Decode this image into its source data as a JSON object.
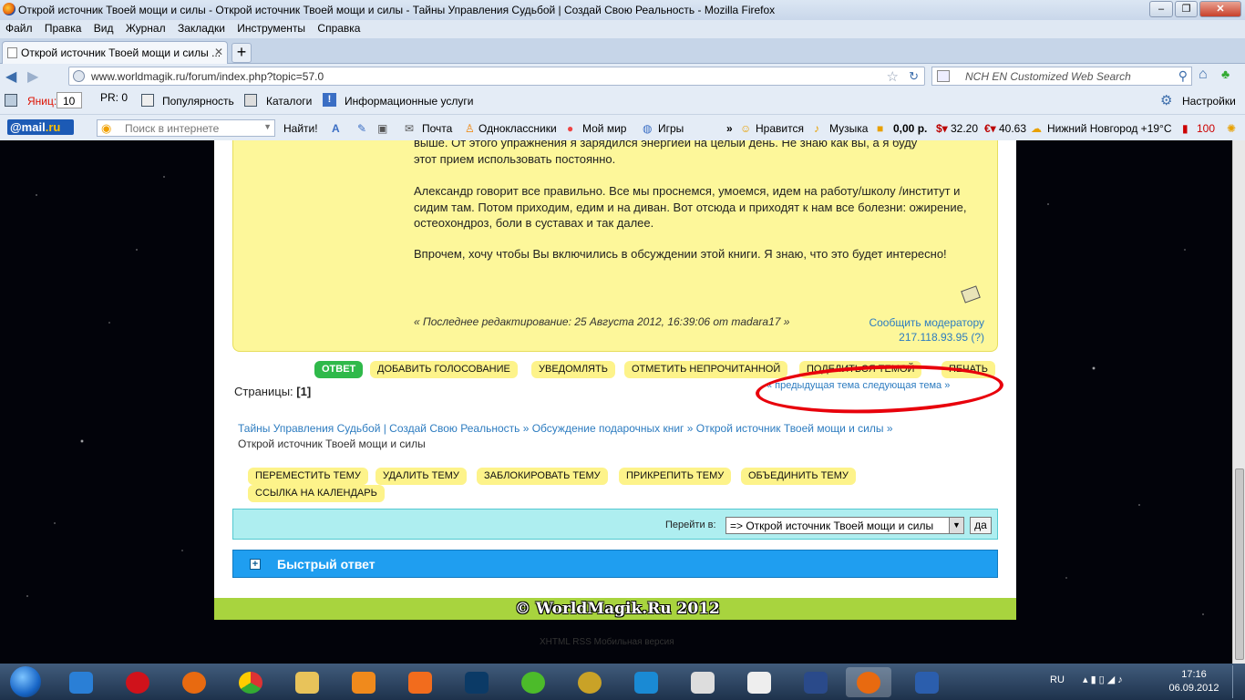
{
  "window": {
    "title": "Открой источник Твоей мощи и силы - Открой источник Твоей мощи и силы - Тайны Управления Судьбой | Создай Свою Реальность - Mozilla Firefox"
  },
  "menu": [
    "Файл",
    "Правка",
    "Вид",
    "Журнал",
    "Закладки",
    "Инструменты",
    "Справка"
  ],
  "tab": {
    "label": "Открой источник Твоей мощи и силы ..."
  },
  "nav": {
    "url": "www.worldmagik.ru/forum/index.php?topic=57.0",
    "search_placeholder": "NCH EN Customized Web Search"
  },
  "toolbar1": {
    "yandex": "Яниц:",
    "tic": "10",
    "pr": "PR: 0",
    "popularity": "Популярность",
    "catalogs": "Каталоги",
    "info": "Информационные услуги",
    "settings": "Настройки"
  },
  "toolbar2": {
    "mailru_a": "@mail",
    "mailru_b": ".ru",
    "search_placeholder": "Поиск в интернете",
    "find": "Найти!",
    "mail": "Почта",
    "ok": "Одноклассники",
    "myworld": "Мой мир",
    "games": "Игры",
    "more": "»",
    "likes": "Нравится",
    "music": "Музыка",
    "money": "0,00 р.",
    "usd": "32.20",
    "eur": "40.63",
    "weather": "Нижний Новгород +19°С",
    "count": "100"
  },
  "post": {
    "p1a": "выше. От этого упражнения я зарядился энергией на целый день. Не знаю как вы, а я буду",
    "p1b": "этот прием использовать постоянно.",
    "p2": "Александр говорит все правильно. Все мы проснемся, умоемся, идем на работу/школу /институт и сидим там. Потом приходим, едим и на диван. Вот отсюда и приходят к нам все болезни: ожирение, остеохондроз, боли в суставах и так далее.",
    "p3": "Впрочем, хочу чтобы Вы включились в обсуждении этой книги. Я знаю, что это будет интересно!",
    "edited": "« Последнее редактирование: 25 Августа 2012, 16:39:06 от madara17 »",
    "report": "Сообщить модератору",
    "ip": "217.118.93.95 (?)"
  },
  "buttons": {
    "reply": "ОТВЕТ",
    "poll": "ДОБАВИТЬ ГОЛОСОВАНИЕ",
    "notify": "УВЕДОМЛЯТЬ",
    "unread": "ОТМЕТИТЬ НЕПРОЧИТАННОЙ",
    "share": "ПОДЕЛИТЬСЯ ТЕМОЙ",
    "print": "ПЕЧАТЬ"
  },
  "pagination": {
    "label": "Страницы: ",
    "current": "[1]",
    "prevnext": "« предыдущая тема следующая тема »"
  },
  "breadcrumbs": {
    "c1": "Тайны Управления Судьбой | Создай Свою Реальность",
    "sep": " » ",
    "c2": "Обсуждение подарочных книг",
    "c3": "Открой источник Твоей мощи и силы",
    "current": "Открой источник Твоей мощи и силы"
  },
  "mod_buttons": [
    "ПЕРЕМЕСТИТЬ ТЕМУ",
    "УДАЛИТЬ ТЕМУ",
    "ЗАБЛОКИРОВАТЬ ТЕМУ",
    "ПРИКРЕПИТЬ ТЕМУ",
    "ОБЪЕДИНИТЬ ТЕМУ",
    "ССЫЛКА НА КАЛЕНДАРЬ"
  ],
  "jump": {
    "label": "Перейти в:",
    "selected": "=> Открой источник Твоей мощи и силы",
    "go": "да"
  },
  "quick_reply": {
    "label": "Быстрый ответ"
  },
  "footer": {
    "copyright": "© WorldMagik.Ru  2012",
    "links": "XHTML  RSS  Мобильная версия"
  },
  "taskbar": {
    "lang": "RU",
    "time": "17:16",
    "date": "06.09.2012"
  },
  "colors": {
    "post_bg": "#fdf79a",
    "accent_blue": "#1f9ef0",
    "footer_green": "#a8d43e",
    "circle": "#e8000b"
  }
}
